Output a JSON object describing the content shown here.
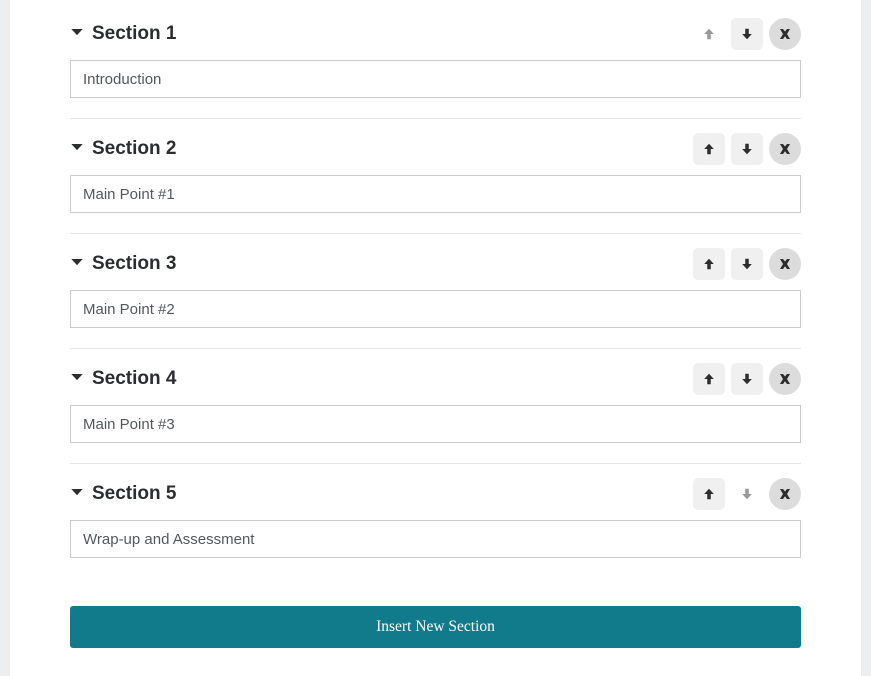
{
  "sections": [
    {
      "title": "Section 1",
      "value": "Introduction",
      "up_enabled": false,
      "down_enabled": true
    },
    {
      "title": "Section 2",
      "value": "Main Point #1",
      "up_enabled": true,
      "down_enabled": true
    },
    {
      "title": "Section 3",
      "value": "Main Point #2",
      "up_enabled": true,
      "down_enabled": true
    },
    {
      "title": "Section 4",
      "value": "Main Point #3",
      "up_enabled": true,
      "down_enabled": true
    },
    {
      "title": "Section 5",
      "value": "Wrap-up and Assessment",
      "up_enabled": true,
      "down_enabled": false
    }
  ],
  "insert_label": "Insert New Section"
}
